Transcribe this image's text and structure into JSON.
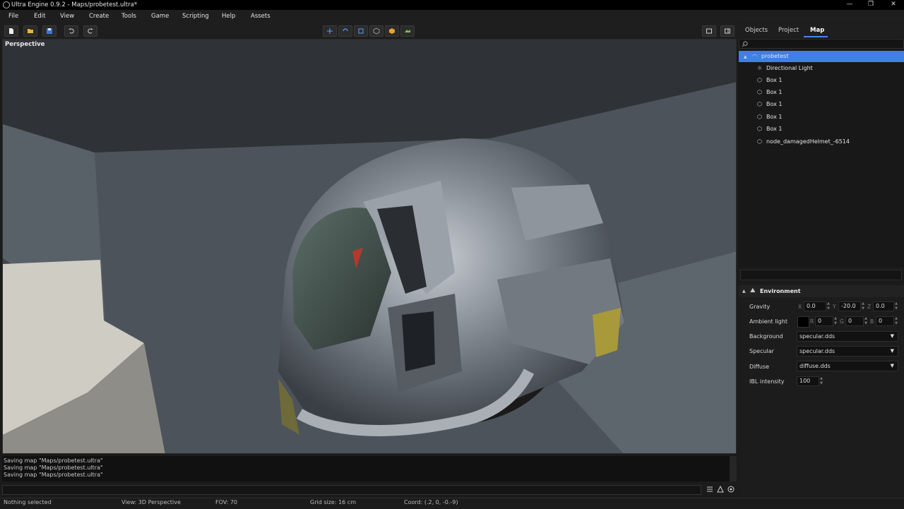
{
  "window": {
    "title": "Ultra Engine 0.9.2 - Maps/probetest.ultra*",
    "minimize": "—",
    "maximize": "❐",
    "close": "✕"
  },
  "menu": [
    "File",
    "Edit",
    "View",
    "Create",
    "Tools",
    "Game",
    "Scripting",
    "Help",
    "Assets"
  ],
  "viewport": {
    "label": "Perspective"
  },
  "console": {
    "lines": [
      "Saving map \"Maps/probetest.ultra\"",
      "Saving map \"Maps/probetest.ultra\"",
      "Saving map \"Maps/probetest.ultra\""
    ]
  },
  "status": {
    "selection": "Nothing selected",
    "view": "View: 3D Perspective",
    "fov": "FOV: 70",
    "grid": "Grid size: 16 cm",
    "coord": "Coord: (.2, 0, -0.-9)"
  },
  "panel": {
    "tabs": [
      "Objects",
      "Project",
      "Map"
    ],
    "tree": [
      {
        "label": "probetest",
        "icon": "map-icon"
      },
      {
        "label": "Directional Light",
        "icon": "light-icon"
      },
      {
        "label": "Box 1",
        "icon": "box-icon"
      },
      {
        "label": "Box 1",
        "icon": "box-icon"
      },
      {
        "label": "Box 1",
        "icon": "box-icon"
      },
      {
        "label": "Box 1",
        "icon": "box-icon"
      },
      {
        "label": "Box 1",
        "icon": "box-icon"
      },
      {
        "label": "node_damagedHelmet_-6514",
        "icon": "box-icon"
      }
    ],
    "environment": {
      "title": "Environment",
      "gravity": {
        "label": "Gravity",
        "x": "0.0",
        "y": "-20.0",
        "z": "0.0"
      },
      "ambient": {
        "label": "Ambient light",
        "r": "0",
        "g": "0",
        "b": "0",
        "color": "#000000"
      },
      "background": {
        "label": "Background",
        "value": "specular.dds"
      },
      "specular": {
        "label": "Specular",
        "value": "specular.dds"
      },
      "diffuse": {
        "label": "Diffuse",
        "value": "diffuse.dds"
      },
      "ibl": {
        "label": "IBL intensity",
        "value": "100"
      }
    }
  },
  "axis_labels": {
    "x": "X",
    "y": "Y",
    "z": "Z",
    "r": "R",
    "g": "G",
    "b": "B"
  },
  "colors": {
    "accent": "#3f7fe6"
  }
}
